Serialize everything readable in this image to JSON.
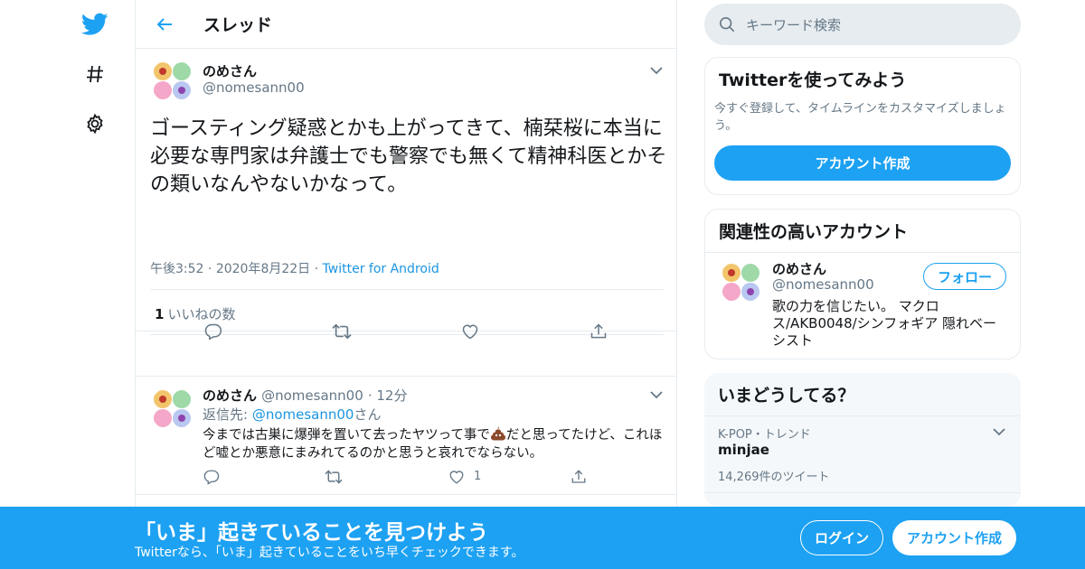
{
  "colors": {
    "accent": "#1da1f2",
    "link": "#1b95e0",
    "text": "#14171a",
    "muted": "#657786",
    "border": "#e6ecf0"
  },
  "header": {
    "title": "スレッド"
  },
  "main_tweet": {
    "name": "のめさん",
    "handle": "@nomesann00",
    "text": "ゴースティング疑惑とかも上がってきて、楠栞桜に本当に必要な専門家は弁護士でも警察でも無くて精神科医とかその類いなんやないかなって。",
    "time": "午後3:52",
    "date": "2020年8月22日",
    "source": "Twitter for Android",
    "likes_count": "1",
    "likes_label": "いいねの数"
  },
  "reply_tweet": {
    "name": "のめさん",
    "handle": "@nomesann00",
    "time_ago": "12分",
    "reply_prefix": "返信先: ",
    "reply_to": "@nomesann00",
    "reply_suffix": "さん",
    "text_before_emoji": "今までは古巣に爆弾を置いて去ったヤツって事で",
    "text_after_emoji": "だと思ってたけど、これほど嘘とか悪意にまみれてるのかと思うと哀れでならない。",
    "like_count": "1"
  },
  "sidebar": {
    "search_placeholder": "キーワード検索",
    "signup_card": {
      "title": "Twitterを使ってみよう",
      "desc": "今すぐ登録して、タイムラインをカスタマイズしましょう。",
      "button": "アカウント作成"
    },
    "related_card": {
      "title": "関連性の高いアカウント",
      "name": "のめさん",
      "handle": "@nomesann00",
      "follow": "フォロー",
      "bio": "歌の力を信じたい。 マクロス/AKB0048/シンフォギア 隠れベーシスト"
    },
    "trends_card": {
      "title": "いまどうしてる？",
      "trend_context": "K-POP・トレンド",
      "trend_name": "minjae",
      "trend_count": "14,269件のツイート"
    }
  },
  "bottom_bar": {
    "title": "「いま」起きていることを見つけよう",
    "subtitle": "Twitterなら、「いま」起きていることをいち早くチェックできます。",
    "login": "ログイン",
    "signup": "アカウント作成"
  }
}
